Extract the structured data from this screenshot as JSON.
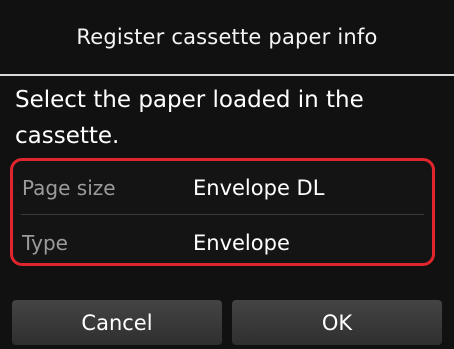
{
  "header": {
    "title": "Register cassette paper info"
  },
  "message": "Select the paper loaded in the cassette.",
  "settings": {
    "items": [
      {
        "label": "Page size",
        "value": "Envelope DL"
      },
      {
        "label": "Type",
        "value": "Envelope"
      }
    ],
    "highlight_color": "#e0262c"
  },
  "buttons": {
    "cancel_label": "Cancel",
    "ok_label": "OK"
  }
}
